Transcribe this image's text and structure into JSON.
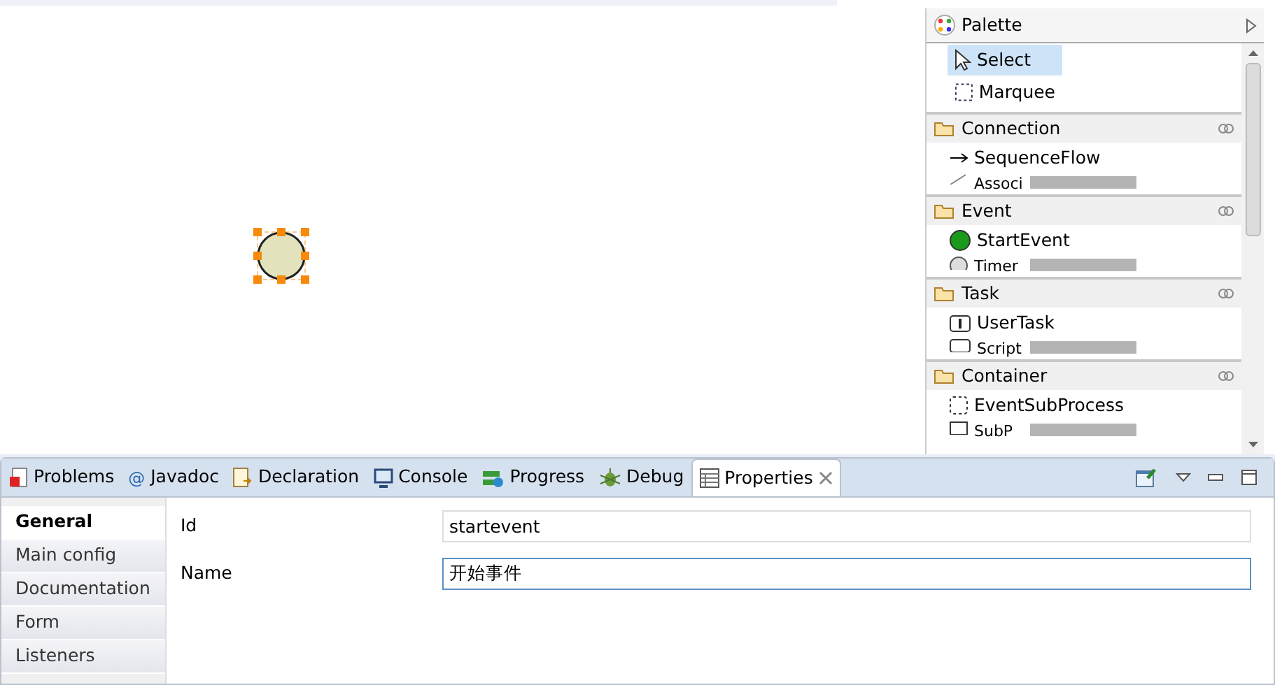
{
  "canvas": {
    "node": {
      "kind": "start-event",
      "selected": true
    }
  },
  "palette": {
    "title": "Palette",
    "tools": [
      {
        "label": "Select",
        "kind": "pointer",
        "selected": true
      },
      {
        "label": "Marquee",
        "kind": "marquee",
        "selected": false
      }
    ],
    "drawers": [
      {
        "title": "Connection",
        "items": [
          {
            "label": "SequenceFlow",
            "kind": "arrow"
          },
          {
            "label": "Associ",
            "kind": "assoc"
          }
        ]
      },
      {
        "title": "Event",
        "items": [
          {
            "label": "StartEvent",
            "kind": "start"
          },
          {
            "label": "Timer",
            "kind": "timer"
          }
        ]
      },
      {
        "title": "Task",
        "items": [
          {
            "label": "UserTask",
            "kind": "user"
          },
          {
            "label": "Script",
            "kind": "script"
          }
        ]
      },
      {
        "title": "Container",
        "items": [
          {
            "label": "EventSubProcess",
            "kind": "dashed"
          },
          {
            "label": "SubP",
            "kind": "sub"
          }
        ]
      }
    ]
  },
  "views": {
    "tabs": [
      {
        "label": "Problems",
        "kind": "problems",
        "selected": false
      },
      {
        "label": "Javadoc",
        "kind": "at",
        "icon_char": "@",
        "selected": false
      },
      {
        "label": "Declaration",
        "kind": "decl",
        "selected": false
      },
      {
        "label": "Console",
        "kind": "console",
        "selected": false
      },
      {
        "label": "Progress",
        "kind": "progress",
        "selected": false
      },
      {
        "label": "Debug",
        "kind": "debug",
        "selected": false
      },
      {
        "label": "Properties",
        "kind": "props",
        "selected": true
      }
    ]
  },
  "properties": {
    "sections": [
      {
        "label": "General",
        "selected": true
      },
      {
        "label": "Main config",
        "selected": false
      },
      {
        "label": "Documentation",
        "selected": false
      },
      {
        "label": "Form",
        "selected": false
      },
      {
        "label": "Listeners",
        "selected": false
      }
    ],
    "fields": [
      {
        "label": "Id",
        "value": "startevent",
        "focused": false
      },
      {
        "label": "Name",
        "value": "开始事件",
        "focused": true
      }
    ]
  }
}
